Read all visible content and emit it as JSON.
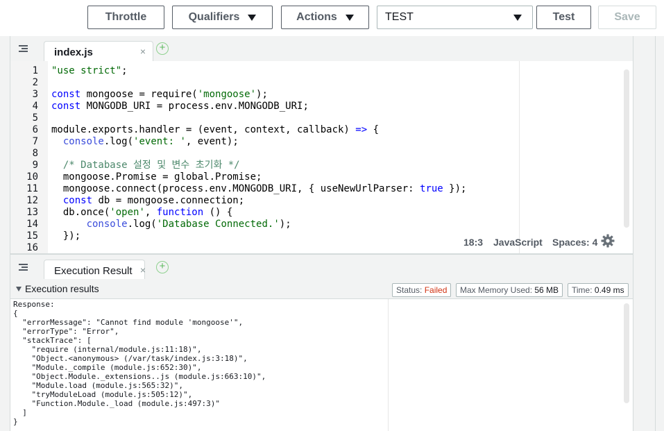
{
  "toolbar": {
    "throttle_label": "Throttle",
    "qualifiers_label": "Qualifiers",
    "actions_label": "Actions",
    "test_event_selected": "TEST",
    "test_label": "Test",
    "save_label": "Save"
  },
  "editor": {
    "tab_label": "index.js",
    "close_glyph": "×",
    "add_glyph": "+",
    "lines": [
      "\"use strict\";",
      "",
      "const mongoose = require('mongoose');",
      "const MONGODB_URI = process.env.MONGODB_URI;",
      "",
      "module.exports.handler = (event, context, callback) => {",
      "  console.log('event: ', event);",
      "",
      "  /* Database 설정 및 변수 초기화 */",
      "  mongoose.Promise = global.Promise;",
      "  mongoose.connect(process.env.MONGODB_URI, { useNewUrlParser: true });",
      "  const db = mongoose.connection;",
      "  db.once('open', function () {",
      "      console.log('Database Connected.');",
      "  });",
      ""
    ],
    "status_position": "18:3",
    "status_language": "JavaScript",
    "status_spaces": "Spaces: 4",
    "settings_icon": "gear-icon"
  },
  "results": {
    "tab_label": "Execution Result",
    "close_glyph": "×",
    "add_glyph": "+",
    "section_title": "Execution results",
    "status_label": "Status:",
    "status_value": "Failed",
    "memory_label": "Max Memory Used:",
    "memory_value": "56 MB",
    "time_label": "Time:",
    "time_value": "0.49 ms",
    "output_lines": [
      "Response:",
      "{",
      "  \"errorMessage\": \"Cannot find module 'mongoose'\",",
      "  \"errorType\": \"Error\",",
      "  \"stackTrace\": [",
      "    \"require (internal/module.js:11:18)\",",
      "    \"Object.<anonymous> (/var/task/index.js:3:18)\",",
      "    \"Module._compile (module.js:652:30)\",",
      "    \"Object.Module._extensions..js (module.js:663:10)\",",
      "    \"Module.load (module.js:565:32)\",",
      "    \"tryModuleLoad (module.js:505:12)\",",
      "    \"Function.Module._load (module.js:497:3)\"",
      "  ]",
      "}"
    ]
  },
  "colors": {
    "failed": "#d13212",
    "keyword": "#0000ff",
    "string": "#036a07",
    "comment": "#4c886b",
    "add_icon": "#5cb85c"
  }
}
